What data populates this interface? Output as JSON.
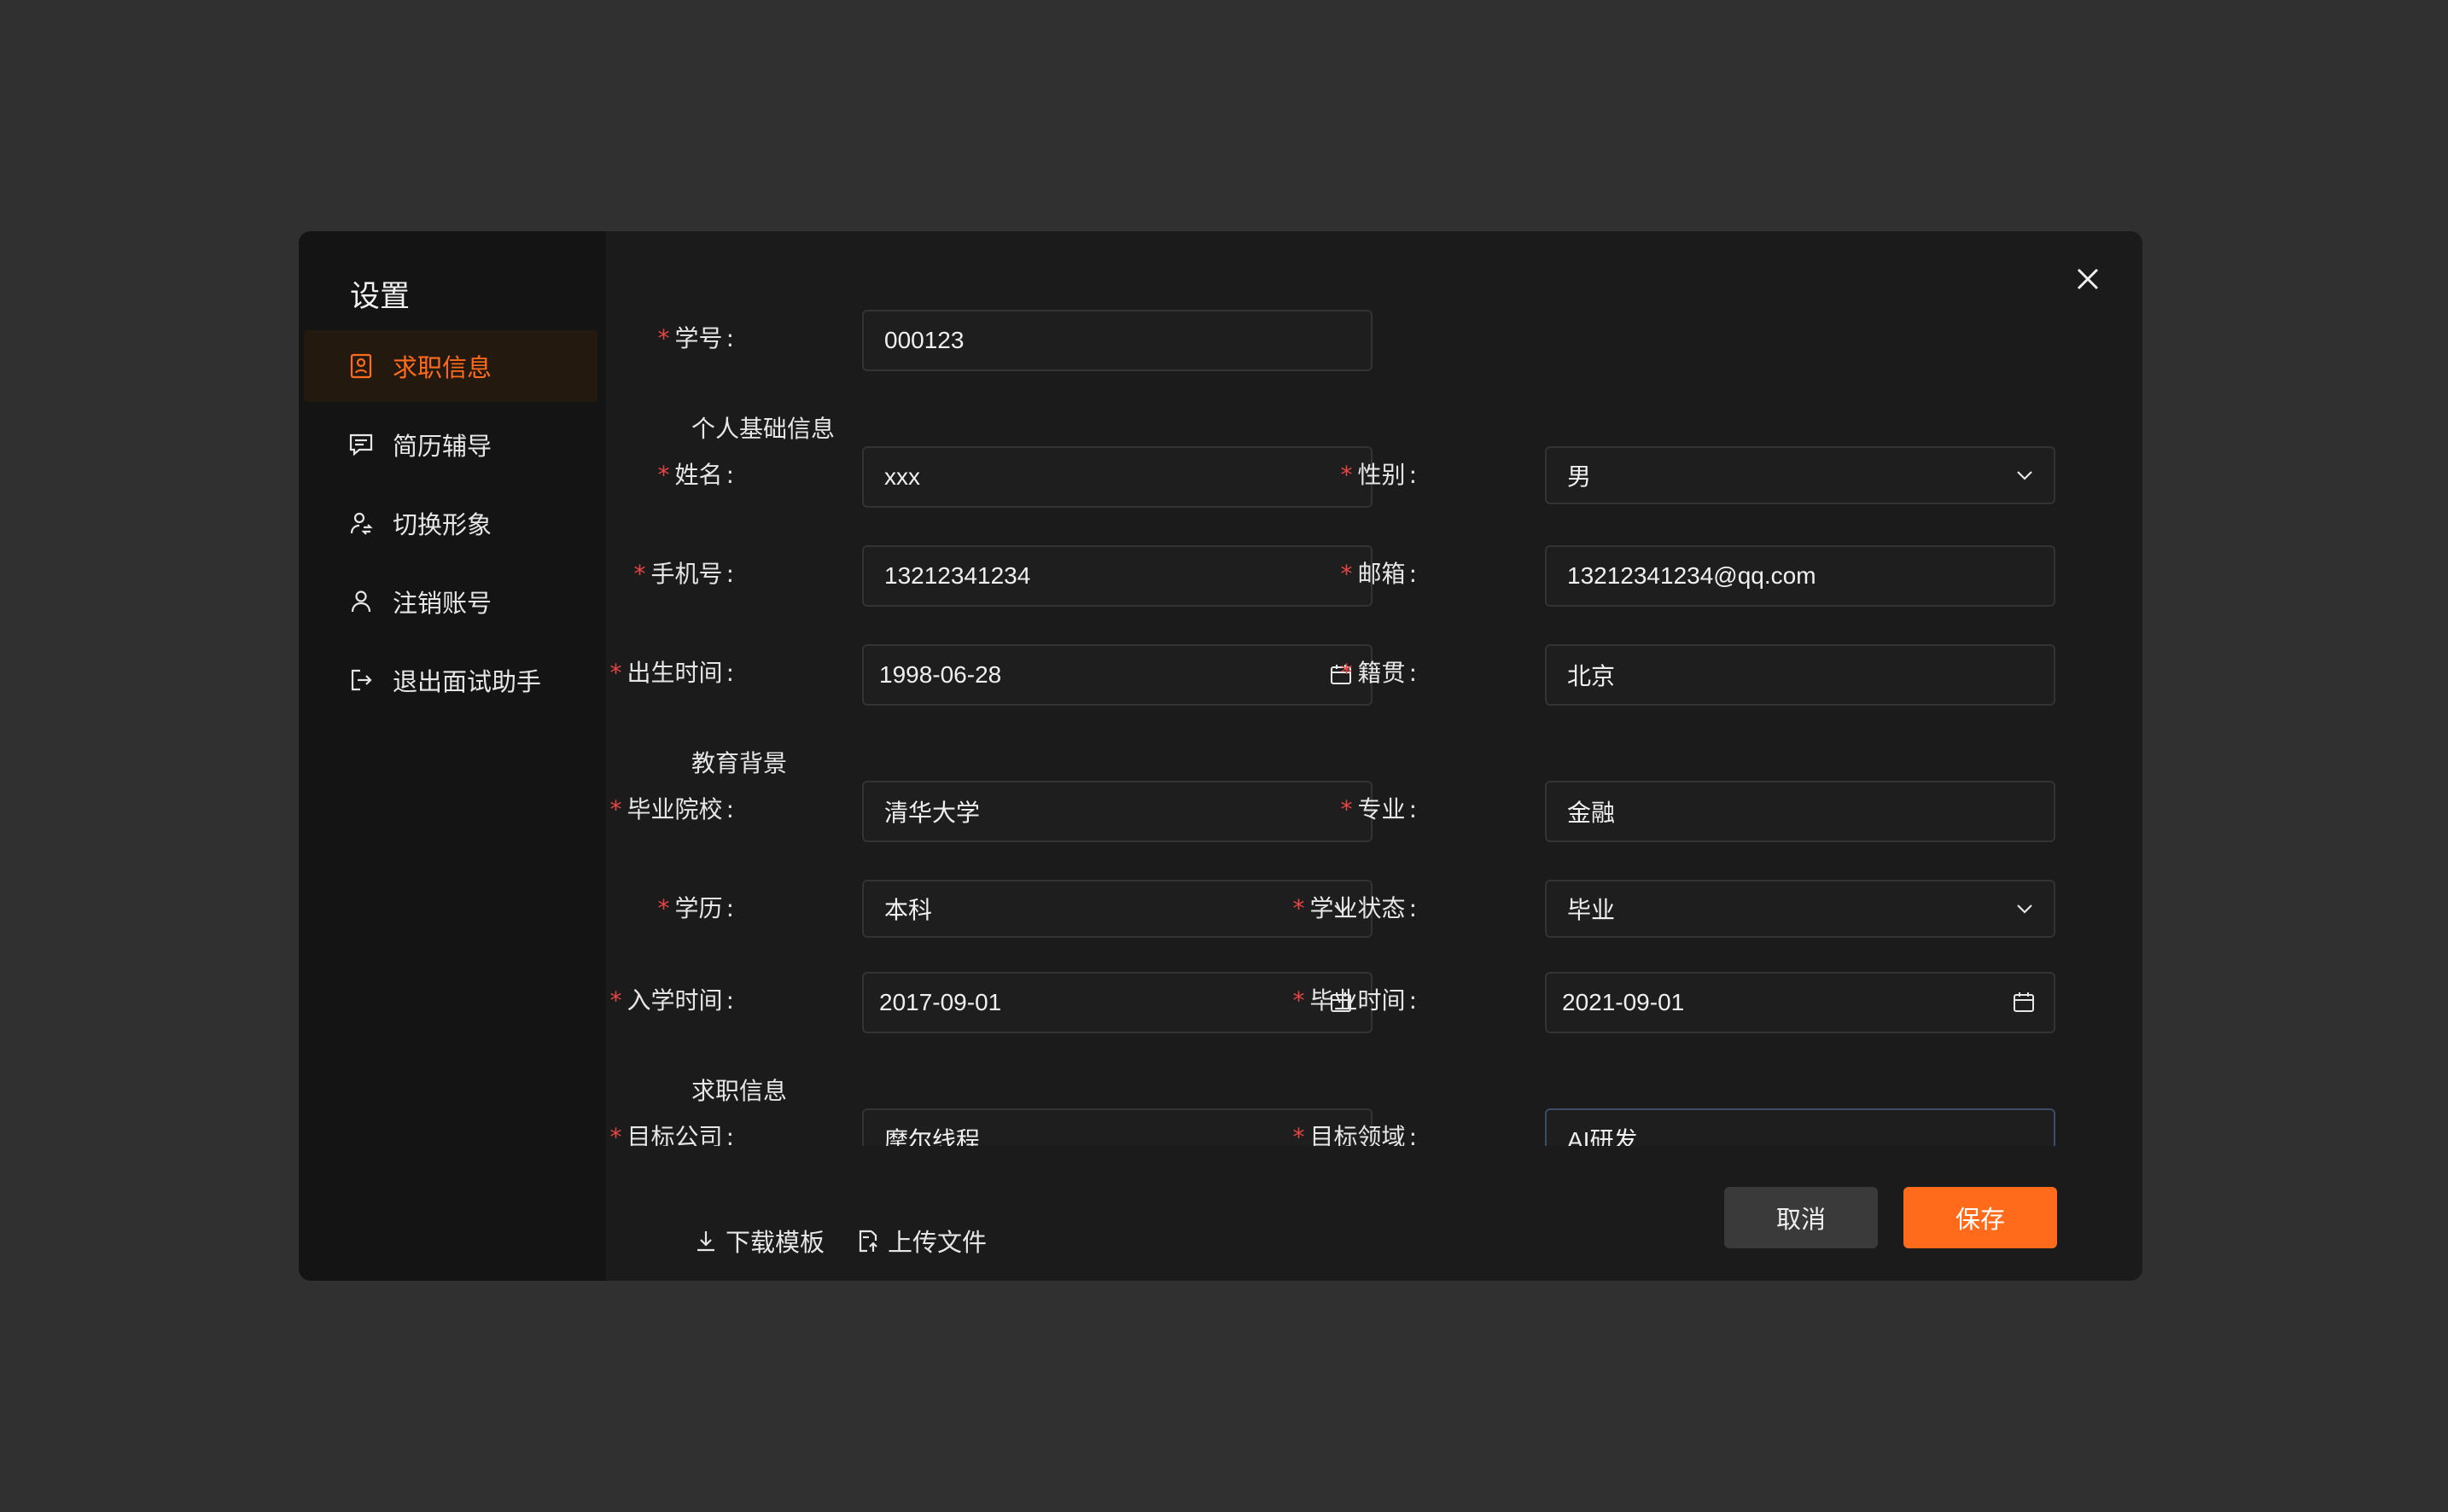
{
  "sidebar": {
    "title": "设置",
    "items": [
      {
        "label": "求职信息",
        "icon": "profile-card-icon",
        "active": true
      },
      {
        "label": "简历辅导",
        "icon": "chat-bubble-icon",
        "active": false
      },
      {
        "label": "切换形象",
        "icon": "switch-user-icon",
        "active": false
      },
      {
        "label": "注销账号",
        "icon": "user-icon",
        "active": false
      },
      {
        "label": "退出面试助手",
        "icon": "logout-icon",
        "active": false
      }
    ]
  },
  "form": {
    "student_id": {
      "label": "学号",
      "value": "000123"
    },
    "sections": {
      "basic": "个人基础信息",
      "education": "教育背景",
      "job": "求职信息"
    },
    "name": {
      "label": "姓名",
      "value": "xxx"
    },
    "gender": {
      "label": "性别",
      "value": "男"
    },
    "phone": {
      "label": "手机号",
      "value": "13212341234"
    },
    "email": {
      "label": "邮箱",
      "value": "13212341234@qq.com"
    },
    "birth_date": {
      "label": "出生时间",
      "value": "1998-06-28"
    },
    "hometown": {
      "label": "籍贯",
      "value": "北京"
    },
    "school": {
      "label": "毕业院校",
      "value": "清华大学"
    },
    "major": {
      "label": "专业",
      "value": "金融"
    },
    "degree": {
      "label": "学历",
      "value": "本科"
    },
    "study_status": {
      "label": "学业状态",
      "value": "毕业"
    },
    "enroll_date": {
      "label": "入学时间",
      "value": "2017-09-01"
    },
    "graduation_date": {
      "label": "毕业时间",
      "value": "2021-09-01"
    },
    "target_company": {
      "label": "目标公司",
      "value": "摩尔线程"
    },
    "target_field": {
      "label": "目标领域",
      "value": "AI研发"
    }
  },
  "footer": {
    "download_label": "下载模板",
    "upload_label": "上传文件",
    "cancel_label": "取消",
    "save_label": "保存"
  },
  "colors": {
    "accent": "#ff6b1a",
    "required": "#e64545",
    "background": "#303030",
    "modal": "#1b1b1b",
    "sidebar": "#141414"
  }
}
